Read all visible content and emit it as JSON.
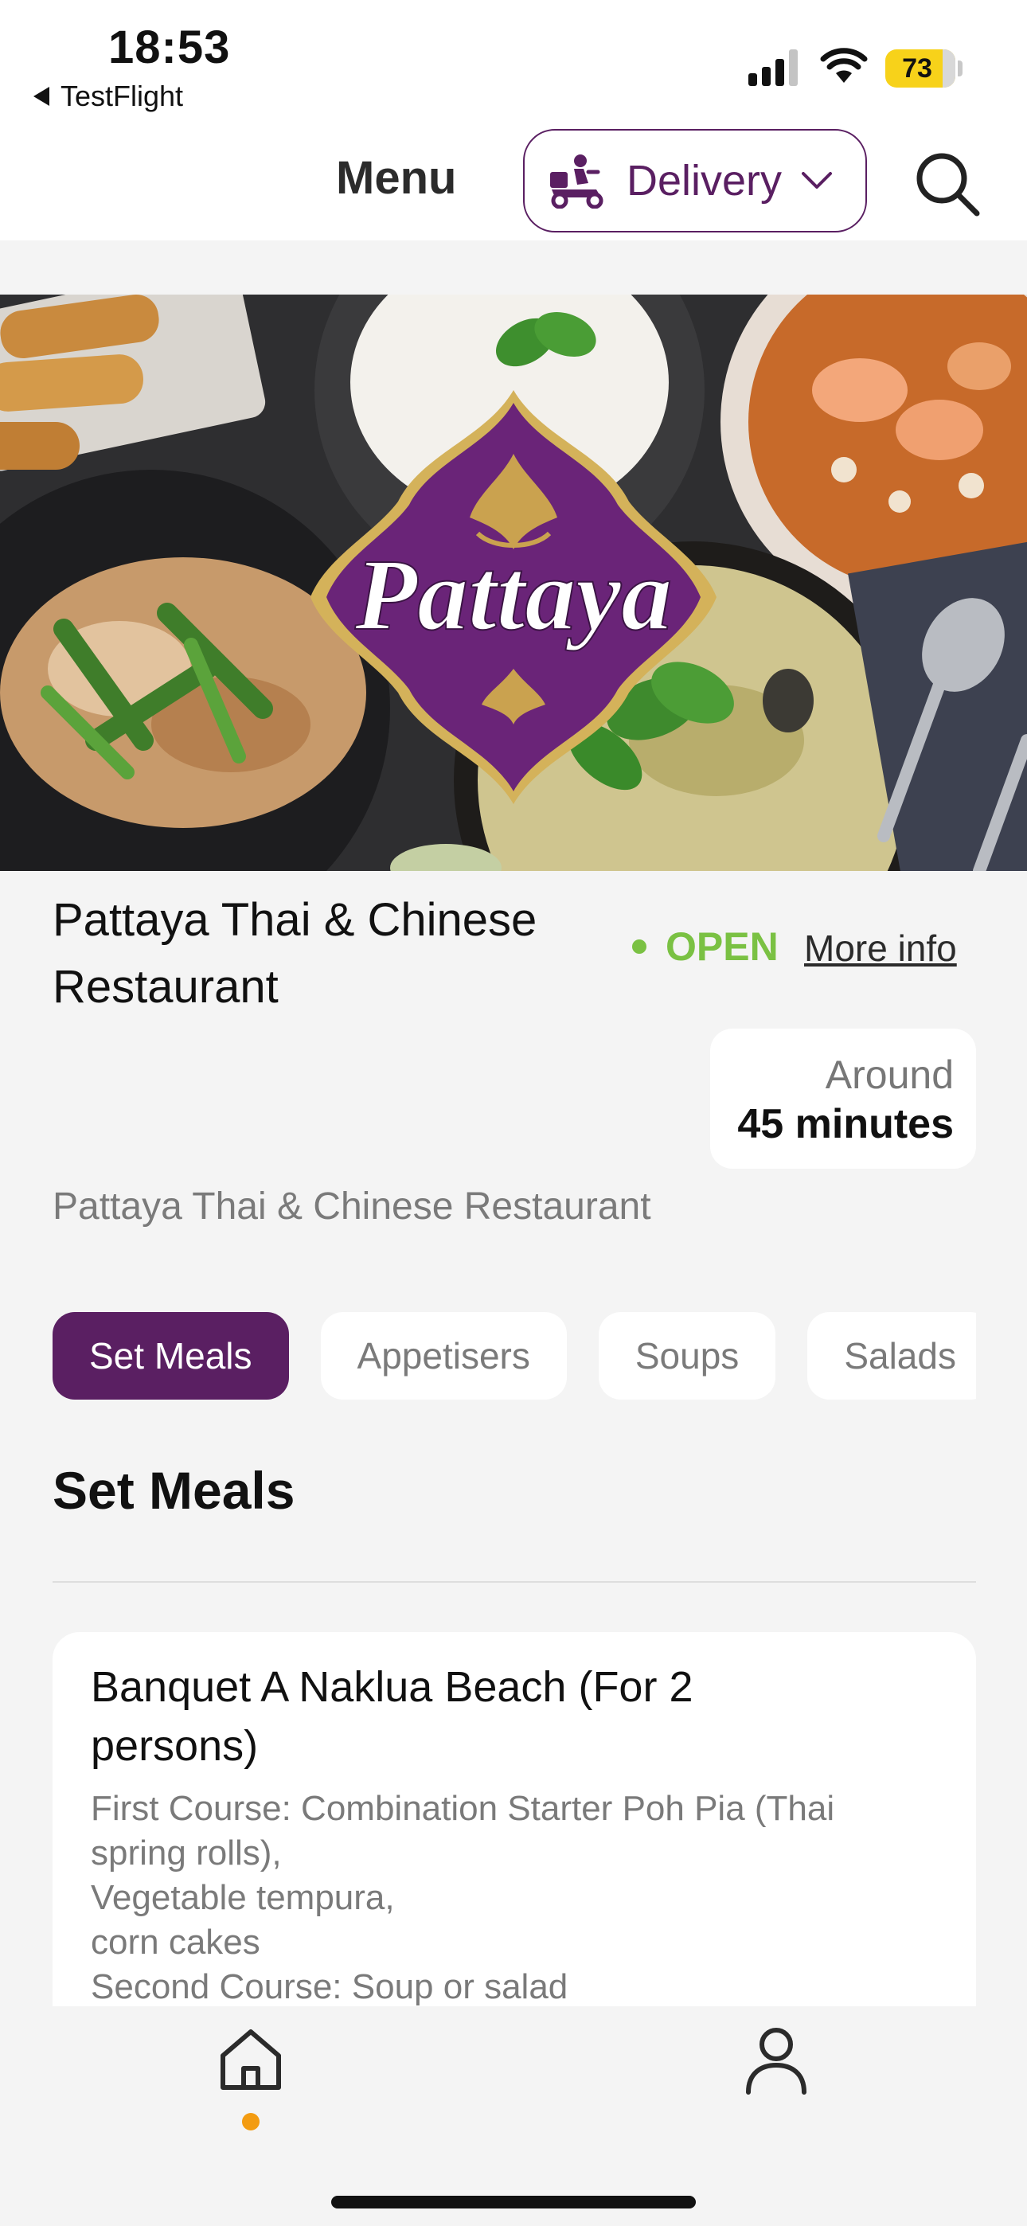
{
  "status_bar": {
    "time": "18:53",
    "back_app": "TestFlight",
    "battery": "73"
  },
  "header": {
    "title": "Menu",
    "delivery_label": "Delivery"
  },
  "hero": {
    "logo_text": "Pattaya"
  },
  "restaurant": {
    "name": "Pattaya Thai & Chinese Restaurant",
    "status": "OPEN",
    "more_info": "More info",
    "eta_prefix": "Around",
    "eta_value": "45 minutes",
    "subtitle": "Pattaya Thai & Chinese Restaurant"
  },
  "categories": {
    "items": [
      "Set Meals",
      "Appetisers",
      "Soups",
      "Salads"
    ],
    "active": "Set Meals"
  },
  "section": {
    "title": "Set Meals"
  },
  "menu_item": {
    "title": "Banquet A Naklua Beach (For 2 persons)",
    "description": "First Course: Combination Starter Poh Pia (Thai spring rolls),\nVegetable tempura,\n corn cakes\n Second Course: Soup or salad"
  },
  "colors": {
    "brand_purple": "#5a1f62",
    "open_green": "#7ac143",
    "nav_dot": "#f39c12",
    "battery_yellow": "#f7d21a"
  },
  "icons": {
    "delivery": "scooter-icon",
    "search": "search-icon",
    "home": "home-icon",
    "profile": "user-icon"
  }
}
